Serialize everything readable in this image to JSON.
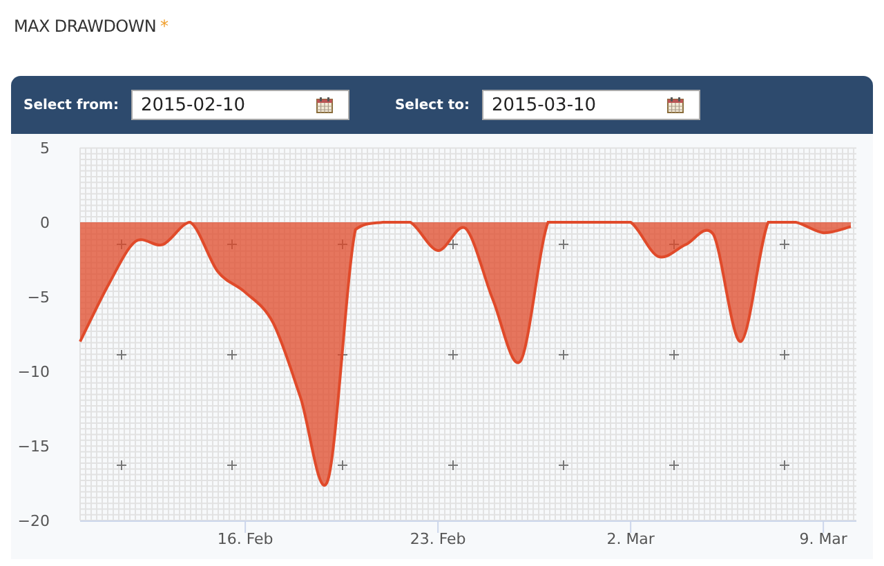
{
  "title": {
    "text": "MAX DRAWDOWN",
    "required_mark": "*"
  },
  "filters": [
    {
      "label": "Select from:",
      "value": "2015-02-10"
    },
    {
      "label": "Select to:",
      "value": "2015-03-10"
    }
  ],
  "chart_data": {
    "type": "area",
    "categories": [
      null,
      null,
      null,
      null,
      null,
      null,
      "16. Feb",
      null,
      null,
      null,
      null,
      null,
      null,
      "23. Feb",
      null,
      null,
      null,
      null,
      null,
      null,
      "2. Mar",
      null,
      null,
      null,
      null,
      null,
      null,
      "9. Mar",
      null
    ],
    "values": [
      -8.0,
      -4.3,
      -1.3,
      -1.5,
      0,
      -3.3,
      -4.7,
      -6.7,
      -11.7,
      -17.3,
      -0.5,
      0,
      0,
      -1.9,
      -0.4,
      -5.2,
      -9.3,
      0,
      0,
      0,
      0,
      -2.3,
      -1.5,
      -0.8,
      -8.0,
      0,
      0,
      -0.7,
      -0.3
    ],
    "ylim": [
      -20,
      5
    ],
    "grid": true,
    "yticks": [
      5,
      0,
      -5,
      -10,
      -15,
      -20
    ]
  }
}
